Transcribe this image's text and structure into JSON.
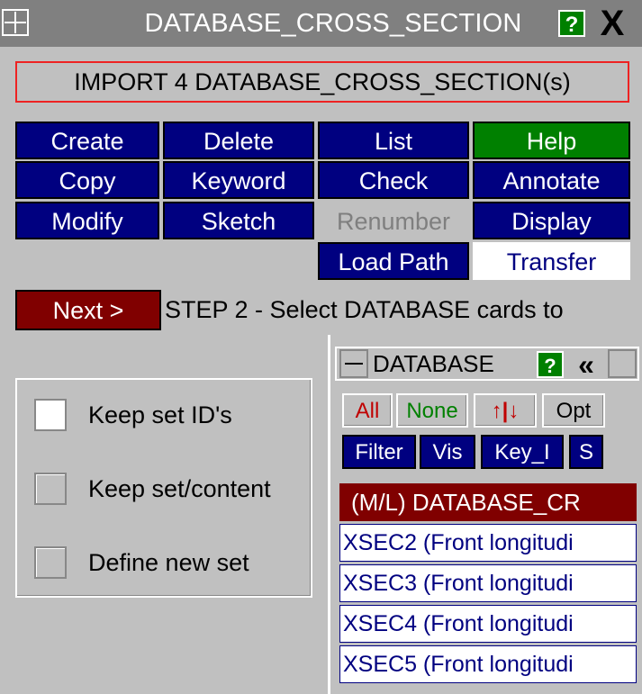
{
  "window": {
    "title": "DATABASE_CROSS_SECTION",
    "help_label": "?",
    "close_label": "X"
  },
  "banner": {
    "text": "IMPORT 4 DATABASE_CROSS_SECTION(s)"
  },
  "buttons": [
    {
      "label": "Create",
      "style": "blue"
    },
    {
      "label": "Delete",
      "style": "blue"
    },
    {
      "label": "List",
      "style": "blue"
    },
    {
      "label": "Help",
      "style": "green"
    },
    {
      "label": "Copy",
      "style": "blue"
    },
    {
      "label": "Keyword",
      "style": "blue"
    },
    {
      "label": "Check",
      "style": "blue"
    },
    {
      "label": "Annotate",
      "style": "blue"
    },
    {
      "label": "Modify",
      "style": "blue"
    },
    {
      "label": "Sketch",
      "style": "blue"
    },
    {
      "label": "Renumber",
      "style": "disabled"
    },
    {
      "label": "Display",
      "style": "blue"
    },
    {
      "label": "Load Path",
      "style": "blue"
    },
    {
      "label": "Transfer",
      "style": "white"
    }
  ],
  "step": {
    "next_label": "Next >",
    "text": "STEP 2 - Select DATABASE cards to"
  },
  "options": [
    {
      "label": "Keep set ID's",
      "checked": true
    },
    {
      "label": "Keep set/content",
      "checked": false
    },
    {
      "label": "Define new set",
      "checked": false
    }
  ],
  "db_panel": {
    "title": "DATABASE",
    "help_label": "?",
    "collapse_label": "«",
    "sel_buttons": {
      "all": "All",
      "none": "None",
      "sort": "↑|↓",
      "opt": "Opt"
    },
    "filter_buttons": {
      "filter": "Filter",
      "vis": "Vis",
      "key": "Key_I",
      "s": "S"
    },
    "header_row": "(M/L) DATABASE_CR",
    "rows": [
      "XSEC2 (Front longitudi",
      "XSEC3 (Front longitudi",
      "XSEC4 (Front longitudi",
      "XSEC5 (Front longitudi"
    ]
  },
  "colors": {
    "button_blue": "#000080",
    "button_green": "#008000",
    "next_red": "#800000",
    "banner_border": "#e22222"
  }
}
